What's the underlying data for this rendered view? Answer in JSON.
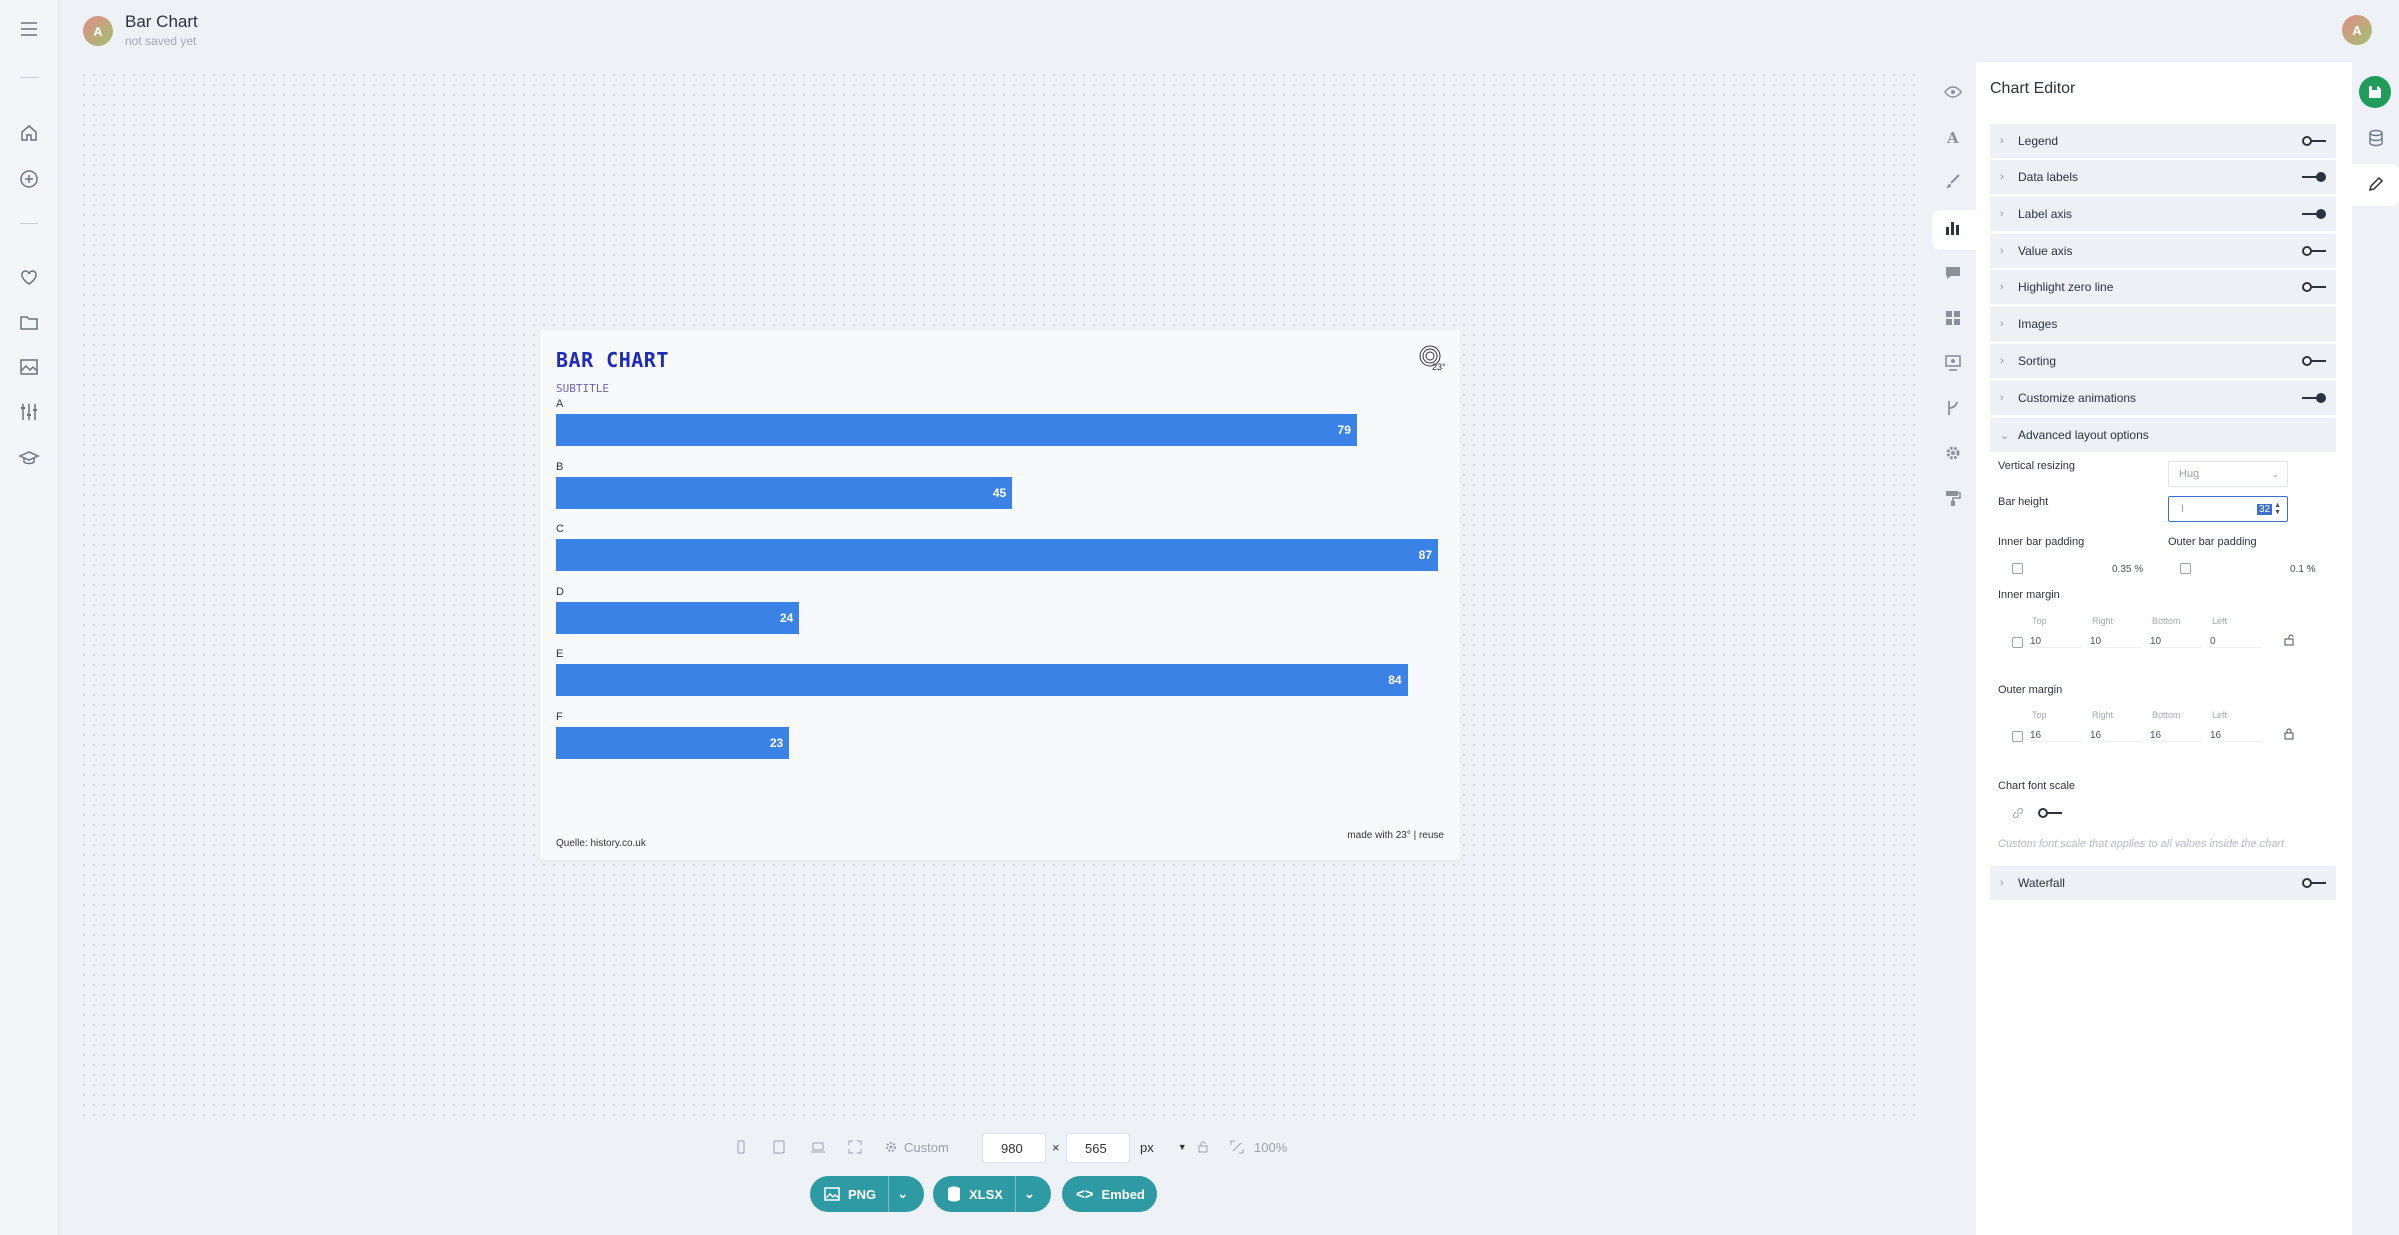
{
  "app": {
    "doc_title": "Bar Chart",
    "save_status": "not saved yet",
    "avatar_letter": "A",
    "accent": "#2e9aa3"
  },
  "rail": {
    "icons": [
      "menu-icon",
      "home-icon",
      "add-icon",
      "heart-icon",
      "folder-icon",
      "image-icon",
      "sliders-icon",
      "graduation-icon"
    ]
  },
  "chart": {
    "title": "Bar Chart",
    "subtitle": "Subtitle",
    "source": "Quelle: history.co.uk",
    "credit": "made with 23° | reuse",
    "bar_color": "#3b82e6"
  },
  "chart_data": {
    "type": "bar",
    "orientation": "horizontal",
    "categories": [
      "A",
      "B",
      "C",
      "D",
      "E",
      "F"
    ],
    "values": [
      79,
      45,
      87,
      24,
      84,
      23
    ],
    "title": "Bar Chart",
    "subtitle": "Subtitle",
    "xlim": [
      0,
      87
    ],
    "grid": false,
    "data_labels": true
  },
  "toolbar": {
    "preset": "Custom",
    "width": "980",
    "height": "565",
    "times": "×",
    "unit": "px",
    "zoom": "100%",
    "exports": [
      "PNG",
      "XLSX",
      "Embed"
    ]
  },
  "editor": {
    "title": "Chart Editor",
    "sections": [
      {
        "label": "Legend",
        "toggle": "off"
      },
      {
        "label": "Data labels",
        "toggle": "on"
      },
      {
        "label": "Label axis",
        "toggle": "on"
      },
      {
        "label": "Value axis",
        "toggle": "off"
      },
      {
        "label": "Highlight zero line",
        "toggle": "off"
      },
      {
        "label": "Images",
        "toggle": "none"
      },
      {
        "label": "Sorting",
        "toggle": "off"
      },
      {
        "label": "Customize animations",
        "toggle": "on"
      },
      {
        "label": "Advanced layout options",
        "toggle": "none"
      }
    ],
    "advanced": {
      "vertical_resizing_label": "Vertical resizing",
      "vertical_resizing_value": "Hug",
      "bar_height_label": "Bar height",
      "bar_height_value": "32",
      "inner_bar_padding_label": "Inner bar padding",
      "inner_bar_padding_value": "0.35 %",
      "outer_bar_padding_label": "Outer bar padding",
      "outer_bar_padding_value": "0.1 %",
      "inner_margin_label": "Inner margin",
      "outer_margin_label": "Outer margin",
      "side_labels": [
        "Top",
        "Right",
        "Bottom",
        "Left"
      ],
      "inner_margin_values": [
        "10",
        "10",
        "10",
        "0"
      ],
      "outer_margin_values": [
        "16",
        "16",
        "16",
        "16"
      ],
      "font_scale_label": "Chart font scale",
      "font_scale_hint": "Custom font scale that applies to all values inside the chart"
    },
    "waterfall_label": "Waterfall"
  }
}
